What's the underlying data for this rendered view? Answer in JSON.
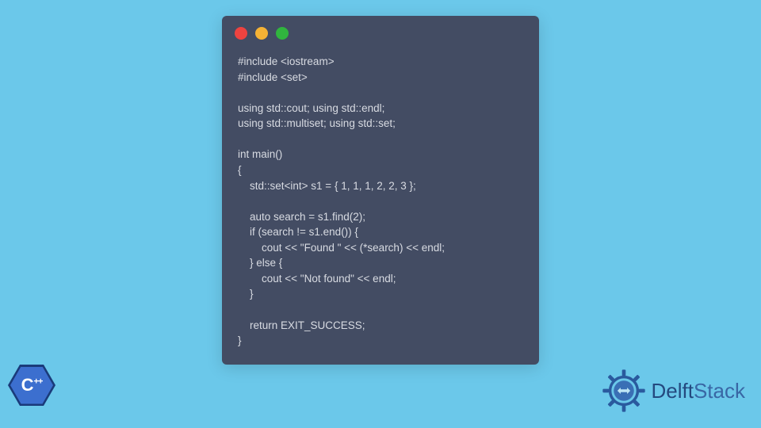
{
  "titlebar": {
    "red": "#ed4340",
    "yellow": "#f5b235",
    "green": "#30b53e"
  },
  "code": {
    "lines": [
      "#include <iostream>",
      "#include <set>",
      "",
      "using std::cout; using std::endl;",
      "using std::multiset; using std::set;",
      "",
      "int main()",
      "{",
      "    std::set<int> s1 = { 1, 1, 1, 2, 2, 3 };",
      "",
      "    auto search = s1.find(2);",
      "    if (search != s1.end()) {",
      "        cout << \"Found \" << (*search) << endl;",
      "    } else {",
      "        cout << \"Not found\" << endl;",
      "    }",
      "",
      "    return EXIT_SUCCESS;",
      "}"
    ]
  },
  "cpp_logo": {
    "label_c": "C",
    "label_plus": "++"
  },
  "delft": {
    "name_part1": "Delft",
    "name_part2": "Stack"
  }
}
